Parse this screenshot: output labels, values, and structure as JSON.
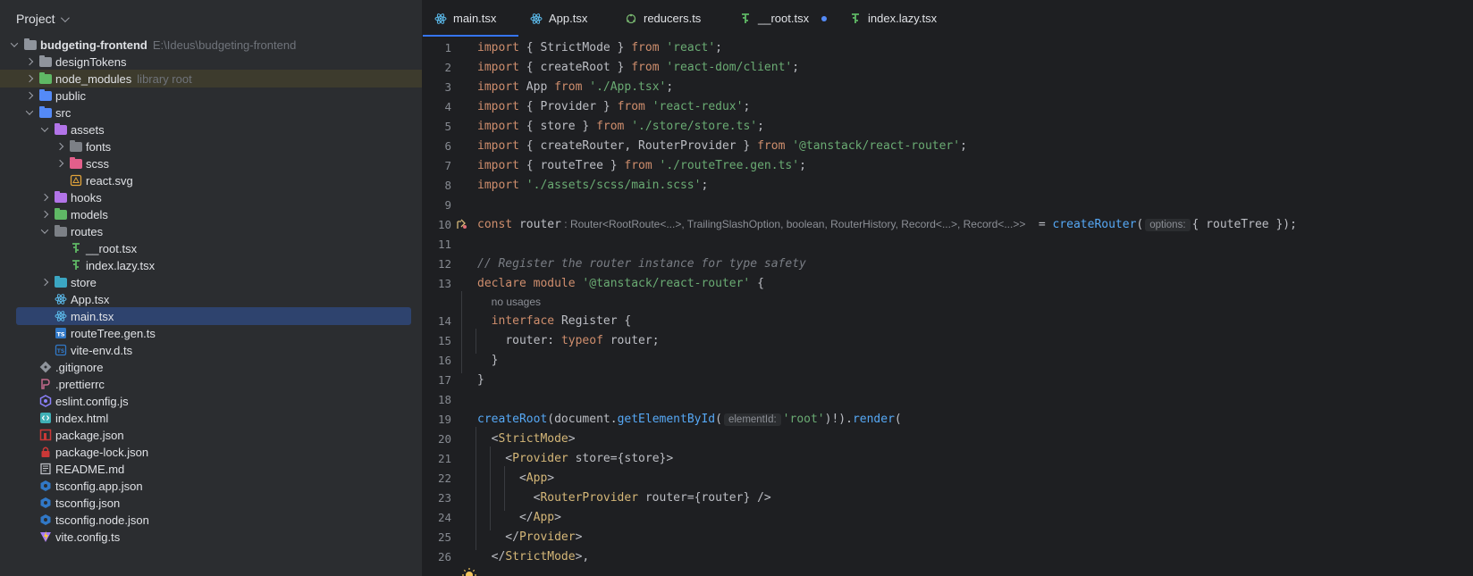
{
  "project": {
    "title": "Project",
    "tree": [
      {
        "label": "budgeting-frontend",
        "hint": "E:\\Ideus\\budgeting-frontend",
        "depth": 0,
        "arrow": "open",
        "icon": "folder"
      },
      {
        "label": "designTokens",
        "depth": 1,
        "arrow": "closed",
        "icon": "folder"
      },
      {
        "label": "node_modules",
        "hint": "library root",
        "depth": 1,
        "arrow": "closed",
        "icon": "folder-green",
        "highlight": true
      },
      {
        "label": "public",
        "depth": 1,
        "arrow": "closed",
        "icon": "folder-blue"
      },
      {
        "label": "src",
        "depth": 1,
        "arrow": "open",
        "icon": "folder-blue"
      },
      {
        "label": "assets",
        "depth": 2,
        "arrow": "open",
        "icon": "folder-purple"
      },
      {
        "label": "fonts",
        "depth": 3,
        "arrow": "closed",
        "icon": "folder-gray"
      },
      {
        "label": "scss",
        "depth": 3,
        "arrow": "closed",
        "icon": "folder-pink"
      },
      {
        "label": "react.svg",
        "depth": 3,
        "arrow": "none",
        "icon": "svg"
      },
      {
        "label": "hooks",
        "depth": 2,
        "arrow": "closed",
        "icon": "folder-purple"
      },
      {
        "label": "models",
        "depth": 2,
        "arrow": "closed",
        "icon": "folder-green"
      },
      {
        "label": "routes",
        "depth": 2,
        "arrow": "open",
        "icon": "folder-gray"
      },
      {
        "label": "__root.tsx",
        "depth": 3,
        "arrow": "none",
        "icon": "route"
      },
      {
        "label": "index.lazy.tsx",
        "depth": 3,
        "arrow": "none",
        "icon": "route"
      },
      {
        "label": "store",
        "depth": 2,
        "arrow": "closed",
        "icon": "folder-teal"
      },
      {
        "label": "App.tsx",
        "depth": 2,
        "arrow": "none",
        "icon": "react"
      },
      {
        "label": "main.tsx",
        "depth": 2,
        "arrow": "none",
        "icon": "react",
        "selected": true
      },
      {
        "label": "routeTree.gen.ts",
        "depth": 2,
        "arrow": "none",
        "icon": "ts"
      },
      {
        "label": "vite-env.d.ts",
        "depth": 2,
        "arrow": "none",
        "icon": "ts-d"
      },
      {
        "label": ".gitignore",
        "depth": 1,
        "arrow": "none",
        "icon": "git"
      },
      {
        "label": ".prettierrc",
        "depth": 1,
        "arrow": "none",
        "icon": "prettier"
      },
      {
        "label": "eslint.config.js",
        "depth": 1,
        "arrow": "none",
        "icon": "eslint"
      },
      {
        "label": "index.html",
        "depth": 1,
        "arrow": "none",
        "icon": "html"
      },
      {
        "label": "package.json",
        "depth": 1,
        "arrow": "none",
        "icon": "npm"
      },
      {
        "label": "package-lock.json",
        "depth": 1,
        "arrow": "none",
        "icon": "lock"
      },
      {
        "label": "README.md",
        "depth": 1,
        "arrow": "none",
        "icon": "md"
      },
      {
        "label": "tsconfig.app.json",
        "depth": 1,
        "arrow": "none",
        "icon": "tsconfig"
      },
      {
        "label": "tsconfig.json",
        "depth": 1,
        "arrow": "none",
        "icon": "tsconfig"
      },
      {
        "label": "tsconfig.node.json",
        "depth": 1,
        "arrow": "none",
        "icon": "tsconfig"
      },
      {
        "label": "vite.config.ts",
        "depth": 1,
        "arrow": "none",
        "icon": "vite"
      }
    ]
  },
  "tabs": [
    {
      "label": "main.tsx",
      "icon": "react",
      "active": true,
      "modified": true
    },
    {
      "label": "App.tsx",
      "icon": "react",
      "active": false,
      "modified": false
    },
    {
      "label": "reducers.ts",
      "icon": "redux",
      "active": false,
      "modified": false
    },
    {
      "label": "__root.tsx",
      "icon": "route",
      "active": false,
      "modified": true
    },
    {
      "label": "index.lazy.tsx",
      "icon": "route",
      "active": false,
      "modified": false
    }
  ],
  "editor": {
    "lines": [
      {
        "n": "1",
        "tokens": [
          [
            "kw",
            "import"
          ],
          [
            "punc",
            " { "
          ],
          [
            "id",
            "StrictMode"
          ],
          [
            "punc",
            " } "
          ],
          [
            "kw",
            "from"
          ],
          [
            "punc",
            " "
          ],
          [
            "str",
            "'react'"
          ],
          [
            "punc",
            ";"
          ]
        ]
      },
      {
        "n": "2",
        "tokens": [
          [
            "kw",
            "import"
          ],
          [
            "punc",
            " { "
          ],
          [
            "id",
            "createRoot"
          ],
          [
            "punc",
            " } "
          ],
          [
            "kw",
            "from"
          ],
          [
            "punc",
            " "
          ],
          [
            "str",
            "'react-dom/client'"
          ],
          [
            "punc",
            ";"
          ]
        ]
      },
      {
        "n": "3",
        "tokens": [
          [
            "kw",
            "import"
          ],
          [
            "punc",
            " "
          ],
          [
            "id",
            "App"
          ],
          [
            "punc",
            " "
          ],
          [
            "kw",
            "from"
          ],
          [
            "punc",
            " "
          ],
          [
            "str",
            "'./App.tsx'"
          ],
          [
            "punc",
            ";"
          ]
        ]
      },
      {
        "n": "4",
        "tokens": [
          [
            "kw",
            "import"
          ],
          [
            "punc",
            " { "
          ],
          [
            "id",
            "Provider"
          ],
          [
            "punc",
            " } "
          ],
          [
            "kw",
            "from"
          ],
          [
            "punc",
            " "
          ],
          [
            "str",
            "'react-redux'"
          ],
          [
            "punc",
            ";"
          ]
        ]
      },
      {
        "n": "5",
        "tokens": [
          [
            "kw",
            "import"
          ],
          [
            "punc",
            " { "
          ],
          [
            "id",
            "store"
          ],
          [
            "punc",
            " } "
          ],
          [
            "kw",
            "from"
          ],
          [
            "punc",
            " "
          ],
          [
            "str",
            "'./store/store.ts'"
          ],
          [
            "punc",
            ";"
          ]
        ]
      },
      {
        "n": "6",
        "tokens": [
          [
            "kw",
            "import"
          ],
          [
            "punc",
            " { "
          ],
          [
            "id",
            "createRouter"
          ],
          [
            "punc",
            ", "
          ],
          [
            "id",
            "RouterProvider"
          ],
          [
            "punc",
            " } "
          ],
          [
            "kw",
            "from"
          ],
          [
            "punc",
            " "
          ],
          [
            "str",
            "'@tanstack/react-router'"
          ],
          [
            "punc",
            ";"
          ]
        ]
      },
      {
        "n": "7",
        "tokens": [
          [
            "kw",
            "import"
          ],
          [
            "punc",
            " { "
          ],
          [
            "id",
            "routeTree"
          ],
          [
            "punc",
            " } "
          ],
          [
            "kw",
            "from"
          ],
          [
            "punc",
            " "
          ],
          [
            "str",
            "'./routeTree.gen.ts'"
          ],
          [
            "punc",
            ";"
          ]
        ]
      },
      {
        "n": "8",
        "tokens": [
          [
            "kw",
            "import"
          ],
          [
            "punc",
            " "
          ],
          [
            "str",
            "'./assets/scss/main.scss'"
          ],
          [
            "punc",
            ";"
          ]
        ]
      },
      {
        "n": "9",
        "tokens": []
      },
      {
        "n": "10",
        "tokens": [
          [
            "kw",
            "const"
          ],
          [
            "punc",
            " "
          ],
          [
            "id",
            "router"
          ],
          [
            "hint",
            " : Router<RootRoute<...>, TrailingSlashOption, boolean, RouterHistory, Record<...>, Record<...>>  "
          ],
          [
            "punc",
            " = "
          ],
          [
            "fn",
            "createRouter"
          ],
          [
            "punc",
            "("
          ],
          [
            "inlay",
            "options:"
          ],
          [
            "punc",
            "{ "
          ],
          [
            "id",
            "routeTree"
          ],
          [
            "punc",
            " });"
          ]
        ],
        "gutter": "run-icon"
      },
      {
        "n": "11",
        "tokens": []
      },
      {
        "n": "12",
        "tokens": [
          [
            "cm",
            "// Register the router instance for type safety"
          ]
        ]
      },
      {
        "n": "13",
        "tokens": [
          [
            "kw",
            "declare"
          ],
          [
            "punc",
            " "
          ],
          [
            "kw",
            "module"
          ],
          [
            "punc",
            " "
          ],
          [
            "str",
            "'@tanstack/react-router'"
          ],
          [
            "punc",
            " {"
          ]
        ]
      },
      {
        "n": "",
        "tokens": [
          [
            "punc",
            "  "
          ],
          [
            "usages",
            "no usages"
          ]
        ]
      },
      {
        "n": "14",
        "tokens": [
          [
            "punc",
            "  "
          ],
          [
            "kw",
            "interface"
          ],
          [
            "punc",
            " "
          ],
          [
            "id",
            "Register"
          ],
          [
            "punc",
            " {"
          ]
        ]
      },
      {
        "n": "15",
        "tokens": [
          [
            "punc",
            "    "
          ],
          [
            "id",
            "router"
          ],
          [
            "punc",
            ": "
          ],
          [
            "kw",
            "typeof"
          ],
          [
            "punc",
            " "
          ],
          [
            "id",
            "router"
          ],
          [
            "punc",
            ";"
          ]
        ]
      },
      {
        "n": "16",
        "tokens": [
          [
            "punc",
            "  }"
          ]
        ]
      },
      {
        "n": "17",
        "tokens": [
          [
            "punc",
            "}"
          ]
        ]
      },
      {
        "n": "18",
        "tokens": []
      },
      {
        "n": "19",
        "tokens": [
          [
            "fn",
            "createRoot"
          ],
          [
            "punc",
            "("
          ],
          [
            "id",
            "document"
          ],
          [
            "punc",
            "."
          ],
          [
            "fn",
            "getElementById"
          ],
          [
            "punc",
            "("
          ],
          [
            "inlay",
            "elementId:"
          ],
          [
            "str",
            "'root'"
          ],
          [
            "punc",
            ")!)."
          ],
          [
            "fn",
            "render"
          ],
          [
            "punc",
            "("
          ]
        ]
      },
      {
        "n": "20",
        "tokens": [
          [
            "punc",
            "  <"
          ],
          [
            "tag",
            "StrictMode"
          ],
          [
            "punc",
            ">"
          ]
        ]
      },
      {
        "n": "21",
        "tokens": [
          [
            "punc",
            "    <"
          ],
          [
            "tag",
            "Provider"
          ],
          [
            "punc",
            " "
          ],
          [
            "id",
            "store"
          ],
          [
            "punc",
            "={"
          ],
          [
            "id",
            "store"
          ],
          [
            "punc",
            "}>"
          ]
        ]
      },
      {
        "n": "22",
        "tokens": [
          [
            "punc",
            "      <"
          ],
          [
            "tag",
            "App"
          ],
          [
            "punc",
            ">"
          ]
        ]
      },
      {
        "n": "23",
        "tokens": [
          [
            "punc",
            "        <"
          ],
          [
            "tag",
            "RouterProvider"
          ],
          [
            "punc",
            " "
          ],
          [
            "id",
            "router"
          ],
          [
            "punc",
            "={"
          ],
          [
            "id",
            "router"
          ],
          [
            "punc",
            "} />"
          ]
        ]
      },
      {
        "n": "24",
        "tokens": [
          [
            "punc",
            "      </"
          ],
          [
            "tag",
            "App"
          ],
          [
            "punc",
            ">"
          ]
        ]
      },
      {
        "n": "25",
        "tokens": [
          [
            "punc",
            "    </"
          ],
          [
            "tag",
            "Provider"
          ],
          [
            "punc",
            ">"
          ]
        ]
      },
      {
        "n": "26",
        "tokens": [
          [
            "punc",
            "  </"
          ],
          [
            "tag",
            "StrictMode"
          ],
          [
            "punc",
            ">,"
          ]
        ]
      }
    ]
  }
}
